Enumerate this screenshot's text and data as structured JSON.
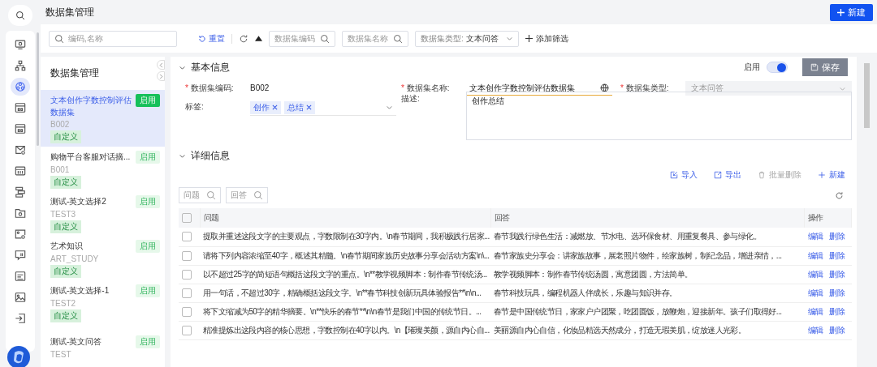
{
  "page_title": "数据集管理",
  "new_button": "新建",
  "nav_icons": [
    {
      "kind": "monitor",
      "selected": false
    },
    {
      "kind": "hierarchy",
      "selected": false
    },
    {
      "kind": "nodes",
      "selected": true
    },
    {
      "kind": "window",
      "selected": false
    },
    {
      "kind": "window",
      "selected": false
    },
    {
      "kind": "mail",
      "selected": false
    },
    {
      "kind": "panel",
      "selected": false
    },
    {
      "kind": "flow",
      "selected": false
    },
    {
      "kind": "folder",
      "selected": false
    },
    {
      "kind": "image",
      "selected": false
    },
    {
      "kind": "chat",
      "selected": false
    },
    {
      "kind": "list",
      "selected": false
    },
    {
      "kind": "photo",
      "selected": false
    },
    {
      "kind": "exit",
      "selected": false
    }
  ],
  "filter_bar": {
    "search": {
      "placeholder": "编码,名称"
    },
    "reset": "重置",
    "fields": [
      {
        "kind": "search",
        "placeholder": "数据集编码"
      },
      {
        "kind": "search",
        "placeholder": "数据集名称"
      },
      {
        "kind": "select",
        "label": "数据集类型:",
        "value": "文本问答"
      }
    ],
    "add_filter": "添加筛选"
  },
  "dataset_list": {
    "title": "数据集管理",
    "items": [
      {
        "name": "文本创作字数控制评估数据集",
        "code": "B002",
        "status": "启用",
        "tag": "自定义",
        "selected": true
      },
      {
        "name": "购物平台客服对话摘...",
        "code": "B001",
        "status": "启用",
        "tag": "自定义",
        "selected": false
      },
      {
        "name": "测试-英文选择2",
        "code": "TEST3",
        "status": "启用",
        "tag": "自定义",
        "selected": false
      },
      {
        "name": "艺术知识",
        "code": "ART_STUDY",
        "status": "启用",
        "tag": "自定义",
        "selected": false
      },
      {
        "name": "测试-英文选择-1",
        "code": "TEST2",
        "status": "启用",
        "tag": "自定义",
        "selected": false
      },
      {
        "name": "测试-英文问答",
        "code": "TEST",
        "status": "启用",
        "selected": false
      }
    ]
  },
  "basic_info": {
    "title": "基本信息",
    "enabled_label": "启用",
    "enabled": true,
    "save": "保存",
    "fields": [
      {
        "kind": "text",
        "mark": "*",
        "label": "数据集编码:",
        "value": "B002"
      },
      {
        "kind": "input",
        "mark": "*",
        "label": "数据集名称:",
        "value": "文本创作字数控制评估数据集"
      },
      {
        "kind": "select",
        "mark": "*",
        "label": "数据集类型:",
        "value": "文本问答",
        "disabled": true
      },
      {
        "kind": "tags",
        "label": "标签:",
        "tags": [
          "创作",
          "总结"
        ]
      },
      {
        "kind": "textarea",
        "label": "描述:",
        "value": "创作总结"
      }
    ]
  },
  "detail_info": {
    "title": "详细信息",
    "actions": [
      {
        "kind": "import",
        "label": "导入",
        "disabled": false
      },
      {
        "kind": "export",
        "label": "导出",
        "disabled": false
      },
      {
        "kind": "delete",
        "label": "批量删除",
        "disabled": true
      },
      {
        "kind": "add",
        "label": "新建",
        "disabled": false
      }
    ],
    "filters": [
      {
        "placeholder": "问题"
      },
      {
        "placeholder": "回答"
      }
    ],
    "table": {
      "all_checked": false,
      "columns": [
        "问题",
        "回答",
        "操作"
      ],
      "rows": [
        {
          "checked": false,
          "question": "提取并重述这段文字的主要观点，字数限制在30字内。\\n春节期间，我积极践行居家...",
          "answer": "春节我践行绿色生活：减燃放、节水电、选环保食材、用重复餐具、参与绿化。",
          "actions": [
            "编辑",
            "删除"
          ]
        },
        {
          "checked": false,
          "question": "请将下列内容浓缩至40字，概述其精髓。\\n春节期间家族历史故事分享会活动方案\\n\\...",
          "answer": "春节家族史分享会：讲家族故事，展老照片物件，绘家族树，制纪念品，增进亲情，...",
          "actions": [
            "编辑",
            "删除"
          ]
        },
        {
          "checked": false,
          "question": "以不超过25字的简短语句概括这段文字的重点。\\n**教学视频脚本：制作春节传统汤...",
          "answer": "教学视频脚本：制作春节传统汤圆，寓意团圆，方法简单。",
          "actions": [
            "编辑",
            "删除"
          ]
        },
        {
          "checked": false,
          "question": "用一句话，不超过30字，精确概括这段文字。\\n**春节科技创新玩具体验报告**\\n\\n...",
          "answer": "春节科技玩具，编程机器人伴成长，乐趣与知识并存。",
          "actions": [
            "编辑",
            "删除"
          ]
        },
        {
          "checked": false,
          "question": "将下文缩减为50字的精华摘要。\\n**快乐的春节**\\n\\n春节是我们中国的传统节日。...",
          "answer": "春节是中国传统节日，家家户户团聚，吃团圆饭，放鞭炮，迎接新年。孩子们取得好...",
          "actions": [
            "编辑",
            "删除"
          ]
        },
        {
          "checked": false,
          "question": "精准提炼出这段内容的核心思想，字数控制在40字以内。\\n【璀璨美颜，源自内心自...",
          "answer": "美丽源自内心自信，化妆品精选天然成分，打造无瑕美肌，绽放迷人光彩。",
          "actions": [
            "编辑",
            "删除"
          ]
        }
      ]
    }
  }
}
